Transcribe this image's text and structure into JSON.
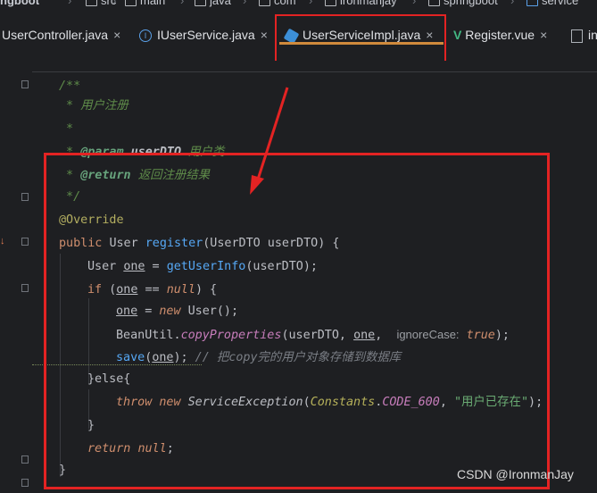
{
  "breadcrumb": {
    "items": [
      "ngboot",
      "src",
      "main",
      "java",
      "com",
      "ironmanjay",
      "springboot",
      "service"
    ]
  },
  "tabs": [
    {
      "label": "UserController.java",
      "active": false
    },
    {
      "label": "IUserService.java",
      "active": false
    },
    {
      "label": "UserServiceImpl.java",
      "active": true
    },
    {
      "label": "Register.vue",
      "active": false
    },
    {
      "label": "in",
      "active": false
    }
  ],
  "tab_close_glyph": "×",
  "code": {
    "doc_open": "/**",
    "doc_register": " * 用户注册",
    "doc_blank": " *",
    "doc_param_star": " * ",
    "doc_param_tag": "@param",
    "doc_param_name": "userDTO",
    "doc_param_desc": "用户类",
    "doc_return_star": " * ",
    "doc_return_tag": "@return",
    "doc_return_desc": "返回注册结果",
    "doc_close": " */",
    "override": "@Override",
    "sig_public": "public",
    "sig_user": "User",
    "sig_method": "register",
    "sig_params": "(UserDTO userDTO) {",
    "l3_type": "User",
    "l3_var": "one",
    "l3_eq": " = ",
    "l3_call": "getUserInfo",
    "l3_args": "(userDTO);",
    "l4_if": "if",
    "l4_open": " (",
    "l4_var": "one",
    "l4_eq": " == ",
    "l4_null": "null",
    "l4_close": ") {",
    "l5_var": "one",
    "l5_eq": " = ",
    "l5_new": "new",
    "l5_ctor": "User",
    "l5_end": "();",
    "l6_class": "BeanUtil",
    "l6_dot": ".",
    "l6_method": "copyProperties",
    "l6_args1": "(userDTO, ",
    "l6_one": "one",
    "l6_comma": ",",
    "l6_hint": "ignoreCase:",
    "l6_true": "true",
    "l6_end": ");",
    "l7_call": "save",
    "l7_open": "(",
    "l7_one": "one",
    "l7_end": ");",
    "l7_comment": " // 把copy完的用户对象存储到数据库",
    "l8_else": "}else{",
    "l9_throw": "throw",
    "l9_new": "new",
    "l9_exc": "ServiceException",
    "l9_open": "(",
    "l9_const_cls": "Constants",
    "l9_dot": ".",
    "l9_const": "CODE_600",
    "l9_comma": ", ",
    "l9_str": "\"用户已存在\"",
    "l9_end": ");",
    "l10": "}",
    "l11_return": "return",
    "l11_null": "null",
    "l11_end": ";",
    "l12": "}"
  },
  "watermark": "CSDN @IronmanJay",
  "colors": {
    "highlight_box": "#e32323",
    "active_tab_underline": "#d08a3c",
    "editor_bg": "#1e1f22"
  }
}
